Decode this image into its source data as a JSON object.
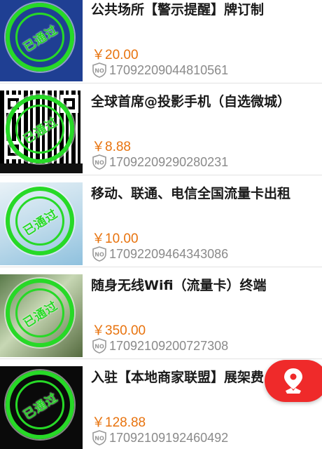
{
  "items": [
    {
      "title": "公共场所【警示提醒】牌订制",
      "price": "￥20.00",
      "code": "17092209044810561",
      "stamp": "已通过"
    },
    {
      "title": "全球首席@投影手机（自选微城）",
      "price": "￥8.88",
      "code": "17092209290280231",
      "stamp": "已通过"
    },
    {
      "title": "移动、联通、电信全国流量卡出租",
      "price": "￥10.00",
      "code": "17092209464343086",
      "stamp": "已通过"
    },
    {
      "title": "随身无线Wifi（流量卡）终端",
      "price": "￥350.00",
      "code": "17092109200727308",
      "stamp": "已通过"
    },
    {
      "title": "入驻【本地商家联盟】展架费",
      "price": "￥128.88",
      "code": "17092109192460492",
      "stamp": "已通过"
    }
  ],
  "icons": {
    "code_icon": "no-badge-icon",
    "float_button_icon": "location-pin-icon"
  },
  "colors": {
    "price": "#e8730e",
    "stamp": "#27d927",
    "float_button": "#ef2a2a",
    "code_text": "#8a8a8a"
  }
}
